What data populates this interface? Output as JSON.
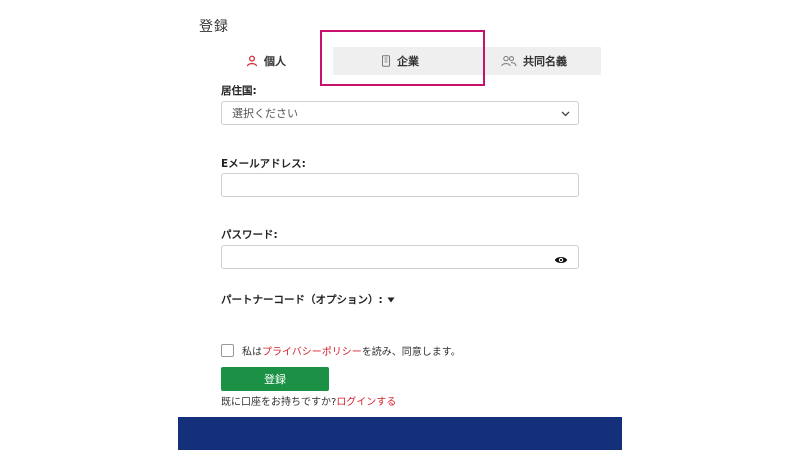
{
  "page": {
    "title": "登録"
  },
  "tabs": [
    {
      "label": "個人",
      "icon": "person-icon",
      "active": true
    },
    {
      "label": "企業",
      "icon": "building-icon",
      "active": false
    },
    {
      "label": "共同名義",
      "icon": "people-icon",
      "active": false
    }
  ],
  "form": {
    "country": {
      "label": "居住国:",
      "placeholder": "選択ください"
    },
    "email": {
      "label": "Eメールアドレス:",
      "value": ""
    },
    "password": {
      "label": "パスワード:",
      "value": ""
    },
    "partner": {
      "label": "パートナーコード（オプション）:"
    },
    "consent": {
      "prefix": "私は",
      "link": "プライバシーポリシー",
      "suffix": "を読み、同意します。"
    },
    "register_label": "登録",
    "login": {
      "prefix": "既に口座をお持ちですか?",
      "link": "ログインする"
    }
  },
  "colors": {
    "highlight": "#c8106e",
    "accent_red": "#d4212f",
    "button_green": "#1a9144",
    "footer_navy": "#14307a"
  }
}
